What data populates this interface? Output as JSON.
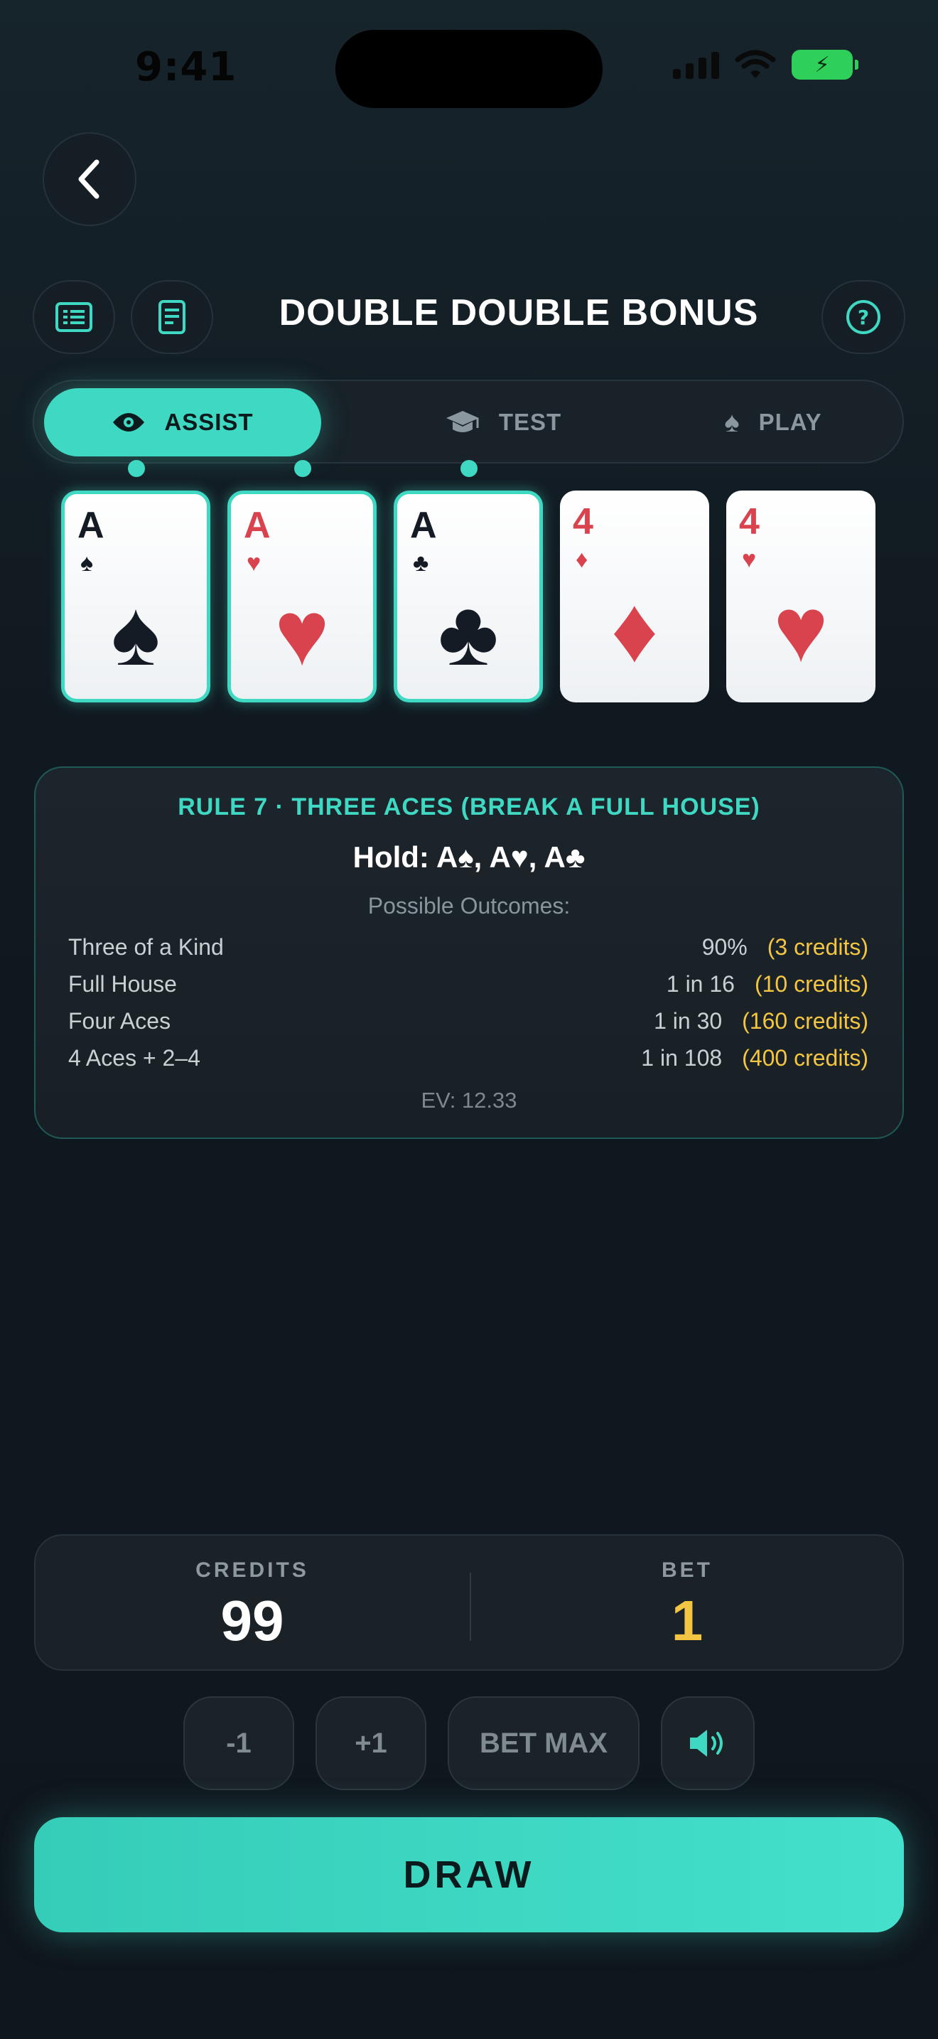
{
  "status": {
    "time": "9:41"
  },
  "header": {
    "title": "DOUBLE DOUBLE BONUS"
  },
  "modes": [
    {
      "label": "ASSIST",
      "icon": "eye-icon",
      "active": true
    },
    {
      "label": "TEST",
      "icon": "graduation-cap-icon",
      "active": false
    },
    {
      "label": "PLAY",
      "icon": "spade-icon",
      "active": false
    }
  ],
  "cards": [
    {
      "rank": "A",
      "suit": "♠",
      "color": "black",
      "held": true
    },
    {
      "rank": "A",
      "suit": "♥",
      "color": "red",
      "held": true
    },
    {
      "rank": "A",
      "suit": "♣",
      "color": "black",
      "held": true
    },
    {
      "rank": "4",
      "suit": "♦",
      "color": "red",
      "held": false
    },
    {
      "rank": "4",
      "suit": "♥",
      "color": "red",
      "held": false
    }
  ],
  "rule": {
    "title": "RULE 7 · THREE ACES (BREAK A FULL HOUSE)",
    "hold": "Hold: A♠, A♥, A♣",
    "subtitle": "Possible Outcomes:",
    "outcomes": [
      {
        "name": "Three of a Kind",
        "odds": "90%",
        "credits": "(3 credits)"
      },
      {
        "name": "Full House",
        "odds": "1 in 16",
        "credits": "(10 credits)"
      },
      {
        "name": "Four Aces",
        "odds": "1 in 30",
        "credits": "(160 credits)"
      },
      {
        "name": "4 Aces + 2–4",
        "odds": "1 in 108",
        "credits": "(400 credits)"
      }
    ],
    "ev": "EV: 12.33"
  },
  "wallet": {
    "credits_label": "CREDITS",
    "credits": "99",
    "bet_label": "BET",
    "bet": "1"
  },
  "controls": {
    "minus_label": "-1",
    "plus_label": "+1",
    "max_label": "BET MAX",
    "sound_icon": "speaker-icon",
    "draw_label": "DRAW"
  },
  "colors": {
    "accent": "#3fd8c2",
    "gold": "#f3c542",
    "red_suit": "#d9434e",
    "background": "#12191f"
  }
}
